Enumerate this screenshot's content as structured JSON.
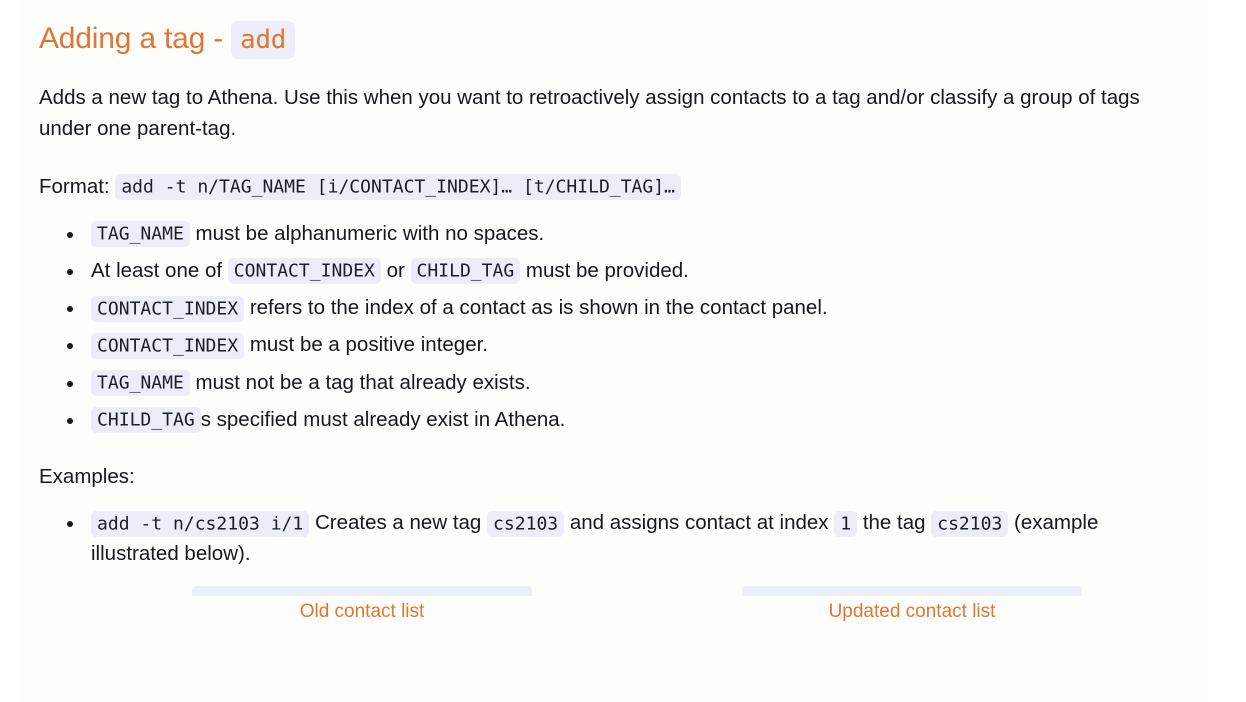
{
  "section": {
    "title_prefix": "Adding a tag - ",
    "title_code": "add"
  },
  "intro": {
    "text": "Adds a new tag to Athena. Use this when you want to retroactively assign contacts to a tag and/or classify a group of tags under one parent-tag."
  },
  "format": {
    "label": "Format: ",
    "code": "add -t n/TAG_NAME [i/CONTACT_INDEX]… [t/CHILD_TAG]…"
  },
  "rules": [
    {
      "code_1": "TAG_NAME",
      "text_1": " must be alphanumeric with no spaces."
    },
    {
      "text_0": "At least one of ",
      "code_1": "CONTACT_INDEX",
      "text_1": " or ",
      "code_2": "CHILD_TAG",
      "text_2": " must be provided."
    },
    {
      "code_1": "CONTACT_INDEX",
      "text_1": " refers to the index of a contact as is shown in the contact panel."
    },
    {
      "code_1": "CONTACT_INDEX",
      "text_1": " must be a positive integer."
    },
    {
      "code_1": "TAG_NAME",
      "text_1": " must not be a tag that already exists."
    },
    {
      "code_1": "CHILD_TAG",
      "text_1": "s specified must already exist in Athena."
    }
  ],
  "examples": {
    "label": "Examples:",
    "items": [
      {
        "code_1": "add -t n/cs2103 i/1",
        "text_1": " Creates a new tag ",
        "code_2": "cs2103",
        "text_2": " and assigns contact at index ",
        "code_3": "1",
        "text_3": " the tag ",
        "code_4": "cs2103",
        "text_4": " (example illustrated below)."
      }
    ]
  },
  "comparison": {
    "old_caption": "Old contact list",
    "updated_caption": "Updated contact list"
  },
  "colors": {
    "accent": "#dd7733",
    "code_bg": "#ecedf8",
    "text": "#16181d",
    "page_bg": "#fdfdfc"
  }
}
